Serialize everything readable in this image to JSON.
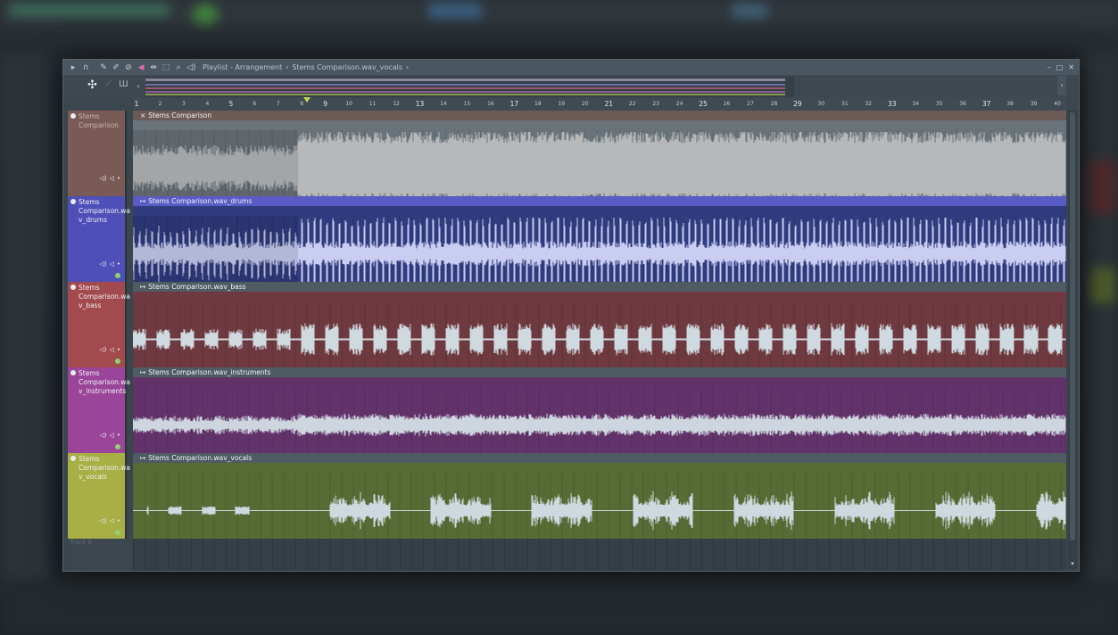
{
  "window": {
    "title": "Playlist - Arrangement",
    "breadcrumb_separator": "›",
    "breadcrumb_clip": "Stems Comparison.wav_vocals",
    "breadcrumb_end": "›"
  },
  "toolbar": {
    "icons": [
      "arrow-icon",
      "magnet-icon",
      "pencil-icon",
      "paint-icon",
      "delete-icon",
      "mute-icon",
      "slip-icon",
      "select-icon",
      "zoom-icon",
      "playback-icon"
    ]
  },
  "ruler": {
    "bars": [
      "1",
      "2",
      "3",
      "4",
      "5",
      "6",
      "7",
      "8",
      "9",
      "10",
      "11",
      "12",
      "13",
      "14",
      "15",
      "16",
      "17",
      "18",
      "19",
      "20",
      "21",
      "22",
      "23",
      "24",
      "25",
      "26",
      "27",
      "28",
      "29",
      "30",
      "31",
      "32",
      "33",
      "34",
      "35",
      "36",
      "37",
      "38",
      "39",
      "40"
    ],
    "major_bars": [
      "1",
      "5",
      "9",
      "13",
      "17",
      "21",
      "25",
      "29",
      "33",
      "37"
    ],
    "playhead_bar": 8.0
  },
  "tracks": [
    {
      "header": "Stems Comparison",
      "clip": "Stems Comparison",
      "color": "#7a5a55",
      "lane_color": "#6a7379",
      "wave_color": "#b6b8ba",
      "kind": "mix"
    },
    {
      "header": "Stems Comparison.wav_drums",
      "clip": "Stems Comparison.wav_drums",
      "color": "#4f4fb8",
      "lane_color": "#2f3c7e",
      "wave_color": "#c9cdf1",
      "kind": "drums"
    },
    {
      "header": "Stems Comparison.wav_bass",
      "clip": "Stems Comparison.wav_bass",
      "color": "#a24a4e",
      "lane_color": "#6e3a3f",
      "wave_color": "#cfd9e0",
      "kind": "bass"
    },
    {
      "header": "Stems Comparison.wav_instruments",
      "clip": "Stems Comparison.wav_instruments",
      "color": "#9a449a",
      "lane_color": "#62336a",
      "wave_color": "#cdd6de",
      "kind": "instruments"
    },
    {
      "header": "Stems Comparison.wav_vocals",
      "clip": "Stems Comparison.wav_vocals",
      "color": "#a7af45",
      "lane_color": "#586b35",
      "wave_color": "#cdd8df",
      "kind": "vocals"
    }
  ],
  "empty_track": {
    "label": "Track 6"
  },
  "track_header_labels": [
    [
      "Stems",
      "Comparison"
    ],
    [
      "Stems",
      "Comparison.wa",
      "v_drums"
    ],
    [
      "Stems",
      "Comparison.wa",
      "v_bass"
    ],
    [
      "Stems",
      "Comparison.wa",
      "v_instruments"
    ],
    [
      "Stems",
      "Comparison.wa",
      "v_vocals"
    ]
  ],
  "window_buttons": {
    "minimize": "–",
    "maximize": "□",
    "close": "✕"
  },
  "clip_prefix": "×",
  "clip_prefix_stem": "↦",
  "corner_buttons": {
    "add": "+",
    "remove": "✕"
  }
}
